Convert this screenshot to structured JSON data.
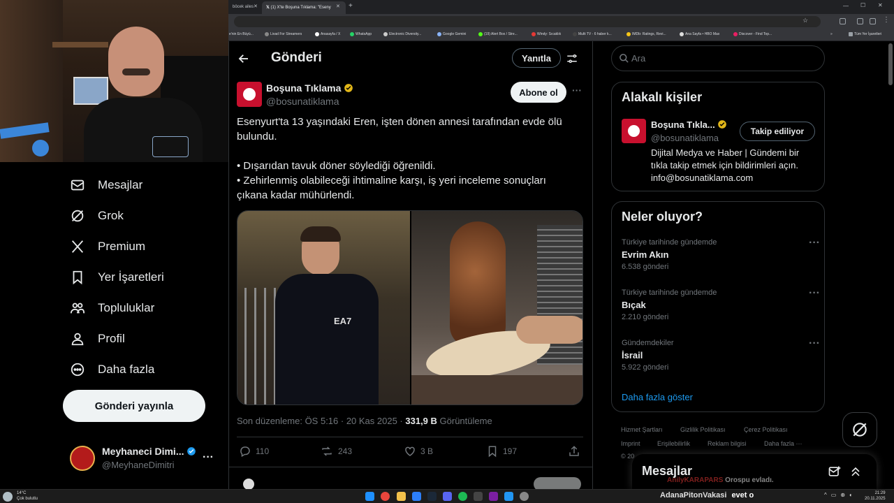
{
  "browser": {
    "tabs": [
      {
        "label": "böcek ailes"
      },
      {
        "label": "(1) X'te Boşuna Tıklama: \"Eseny"
      }
    ],
    "bookmarks": [
      "e'nin En Büyü...",
      "Livad For Streamers",
      "Anasayfa / X",
      "WhatsApp",
      "Electronic Diversity...",
      "Google Gemini",
      "(19) Alert Box / Stre...",
      "Windy: Sıcaklık",
      "Multi TV - 6 haber k...",
      "IMDb: Ratings, Revi...",
      "Ana Sayfa • HBO Max",
      "Discover - Find Top..."
    ],
    "all_bookmarks": "Tüm Yer İşaretleri"
  },
  "sidebar": {
    "items": [
      {
        "label": "Mesajlar",
        "icon": "mail-icon"
      },
      {
        "label": "Grok",
        "icon": "grok-icon"
      },
      {
        "label": "Premium",
        "icon": "x-logo-icon"
      },
      {
        "label": "Yer İşaretleri",
        "icon": "bookmark-icon"
      },
      {
        "label": "Topluluklar",
        "icon": "people-icon"
      },
      {
        "label": "Profil",
        "icon": "person-icon"
      },
      {
        "label": "Daha fazla",
        "icon": "more-circle-icon"
      }
    ],
    "post_button": "Gönderi yayınla",
    "account": {
      "name": "Meyhaneci Dimi...",
      "handle": "@MeyhaneDimitri"
    }
  },
  "header": {
    "title": "Gönderi",
    "reply_button": "Yanıtla"
  },
  "post": {
    "author": "Boşuna Tıklama",
    "handle": "@bosunatiklama",
    "subscribe": "Abone ol",
    "text_line1": "Esenyurt'ta 13 yaşındaki Eren, işten dönen annesi tarafından evde ölü bulundu.",
    "bullet1": "• Dışarıdan tavuk döner söylediği öğrenildi.",
    "bullet2": "• Zehirlenmiş olabileceği ihtimaline karşı, iş yeri inceleme sonuçları çıkana kadar mühürlendi.",
    "meta": "Son düzenleme: ÖS 5:16 · 20 Kas 2025 · ",
    "views": "331,9 B",
    "views_label": " Görüntüleme",
    "stats": {
      "replies": "110",
      "reposts": "243",
      "likes": "3 B",
      "bookmarks": "197"
    }
  },
  "search": {
    "placeholder": "Ara"
  },
  "related": {
    "title": "Alakalı kişiler",
    "name": "Boşuna Tıkla...",
    "handle": "@bosunatiklama",
    "follow": "Takip ediliyor",
    "bio": "Dijital Medya ve Haber | Gündemi bir tıkla takip etmek için bildirimleri açın. info@bosunatiklama.com"
  },
  "trends": {
    "title": "Neler oluyor?",
    "items": [
      {
        "context": "Türkiye tarihinde gündemde",
        "name": "Evrim Akın",
        "count": "6.538 gönderi"
      },
      {
        "context": "Türkiye tarihinde gündemde",
        "name": "Bıçak",
        "count": "2.210 gönderi"
      },
      {
        "context": "Gündemdekiler",
        "name": "İsrail",
        "count": "5.922 gönderi"
      }
    ],
    "show_more": "Daha fazla göster"
  },
  "footer": {
    "links": [
      "Hizmet Şartları",
      "Gizlilik Politikası",
      "Çerez Politikası",
      "Imprint",
      "Erişilebilirlik",
      "Reklam bilgisi",
      "Daha fazla ···"
    ],
    "copyright": "© 20"
  },
  "messages_drawer": {
    "title": "Mesajlar"
  },
  "overlay": {
    "chat_user": "AnilyKARAPARS",
    "chat_msg": "Orospu evladı.",
    "ticker_user": "AdanaPitonVakasi",
    "ticker_msg": "evet o"
  },
  "taskbar": {
    "weather_temp": "14°C",
    "weather_desc": "Çok bulutlu",
    "time": "21:29",
    "date": "20.11.2025"
  },
  "colors": {
    "accent": "#1d9bf0",
    "verified_gold": "#e2b719",
    "brand_red": "#c8102e"
  }
}
